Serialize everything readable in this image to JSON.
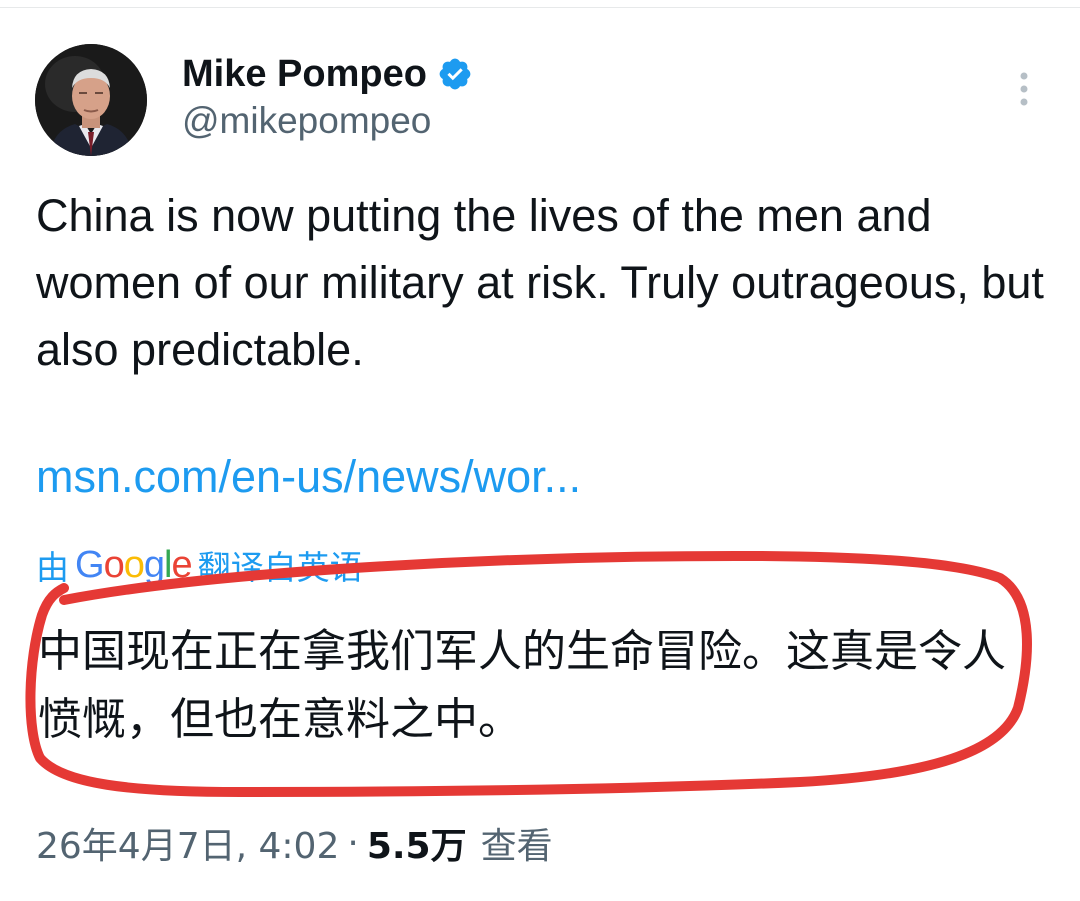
{
  "tweet": {
    "author": {
      "display_name": "Mike Pompeo",
      "handle": "@mikepompeo",
      "verified_icon": "verified-badge-icon",
      "avatar": "profile-photo"
    },
    "more_icon": "more-vertical-icon",
    "text": "China is now putting the lives of the men and women of our military at risk. Truly outrageous, but also predictable.",
    "link_text": "msn.com/en-us/news/wor...",
    "translation": {
      "prefix": "由",
      "provider_letters": [
        "G",
        "o",
        "o",
        "g",
        "l",
        "e"
      ],
      "suffix": "翻译自英语",
      "text": "中国现在正在拿我们军人的生命冒险。这真是令人愤慨，但也在意料之中。"
    },
    "meta": {
      "timestamp": "26年4月7日, 4:02",
      "separator": "·",
      "view_count": "5.5万",
      "views_label": "查看"
    }
  },
  "colors": {
    "link": "#1d9bf0",
    "secondary_text": "#536471",
    "annotation_red": "#e53935"
  }
}
